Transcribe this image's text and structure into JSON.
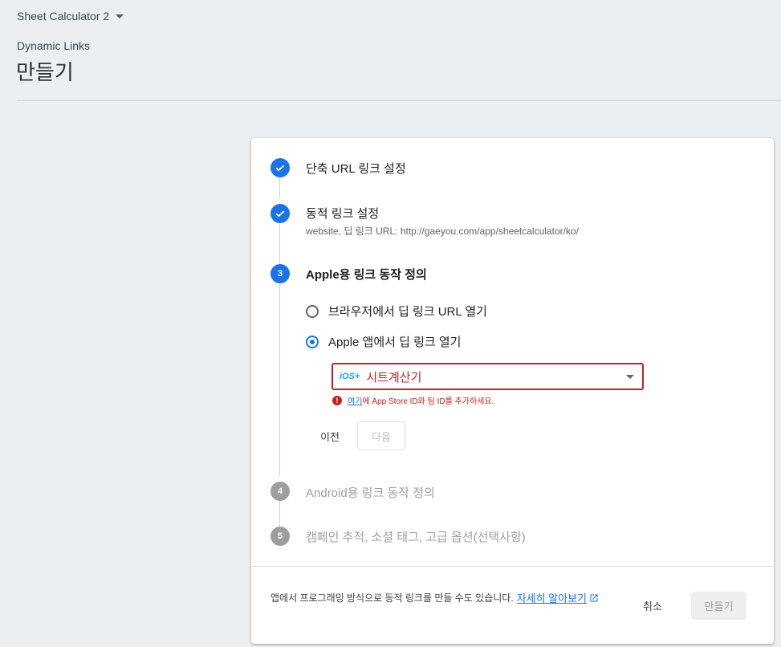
{
  "header": {
    "project_name": "Sheet Calculator 2",
    "section_label": "Dynamic Links",
    "page_title": "만들기"
  },
  "steps": [
    {
      "number": "1",
      "status": "done",
      "title": "단축 URL 링크 설정"
    },
    {
      "number": "2",
      "status": "done",
      "title": "동적 링크 설정",
      "subtitle": "website, 딥 링크 URL: http://gaeyou.com/app/sheetcalculator/ko/"
    },
    {
      "number": "3",
      "status": "active",
      "title": "Apple용 링크 동작 정의"
    },
    {
      "number": "4",
      "status": "pending",
      "title": "Android용 링크 동작 정의"
    },
    {
      "number": "5",
      "status": "pending",
      "title": "캠페인 추적, 소셜 태그, 고급 옵션(선택사항)"
    }
  ],
  "apple_options": {
    "radio_browser": "브라우저에서 딥 링크 URL 열기",
    "radio_app": "Apple 앱에서 딥 링크 열기",
    "selected": "radio_app",
    "app_select": {
      "badge": "iOS+",
      "value": "시트계산기"
    },
    "error": {
      "link": "여기",
      "text": "에 App Store ID와 팀 ID를 추가하세요."
    },
    "prev_button": "이전",
    "next_button": "다음"
  },
  "footer": {
    "text": "앱에서 프로그래밍 방식으로 동적 링크를 만들 수도 있습니다.",
    "link": "자세히 알아보기",
    "cancel_button": "취소",
    "create_button": "만들기"
  },
  "colors": {
    "primary": "#1a73e8",
    "error": "#c5221f",
    "pending": "#9e9e9e"
  }
}
